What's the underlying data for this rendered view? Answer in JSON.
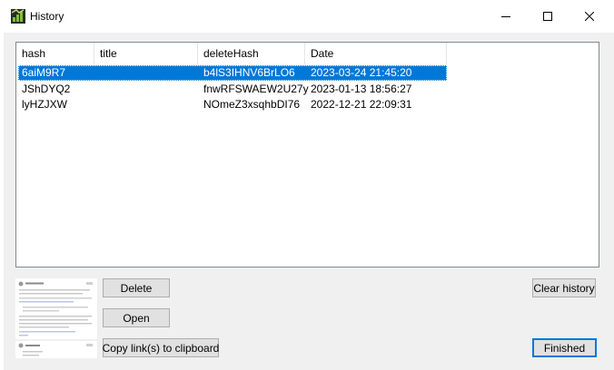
{
  "window": {
    "title": "History"
  },
  "icons": {
    "app": "history-app-icon",
    "minimize": "minimize-icon",
    "maximize": "maximize-icon",
    "close": "close-icon"
  },
  "columns": [
    "hash",
    "title",
    "deleteHash",
    "Date"
  ],
  "rows": [
    {
      "hash": "6aiM9R7",
      "title": "",
      "deleteHash": "b4lS3IHNV6BrLO6",
      "date": "2023-03-24 21:45:20",
      "selected": true
    },
    {
      "hash": "JShDYQ2",
      "title": "",
      "deleteHash": "fnwRFSWAEW2U27y",
      "date": "2023-01-13 18:56:27",
      "selected": false
    },
    {
      "hash": "lyHZJXW",
      "title": "",
      "deleteHash": "NOmeZ3xsqhbDI76",
      "date": "2022-12-21 22:09:31",
      "selected": false
    }
  ],
  "buttons": {
    "delete": "Delete",
    "open": "Open",
    "copy_links": "Copy link(s) to clipboard",
    "clear_history": "Clear history",
    "finished": "Finished"
  },
  "colors": {
    "selection": "#0078d7",
    "button_face": "#e1e1e1",
    "button_border": "#adadad",
    "window_bg": "#f0f0f0"
  }
}
